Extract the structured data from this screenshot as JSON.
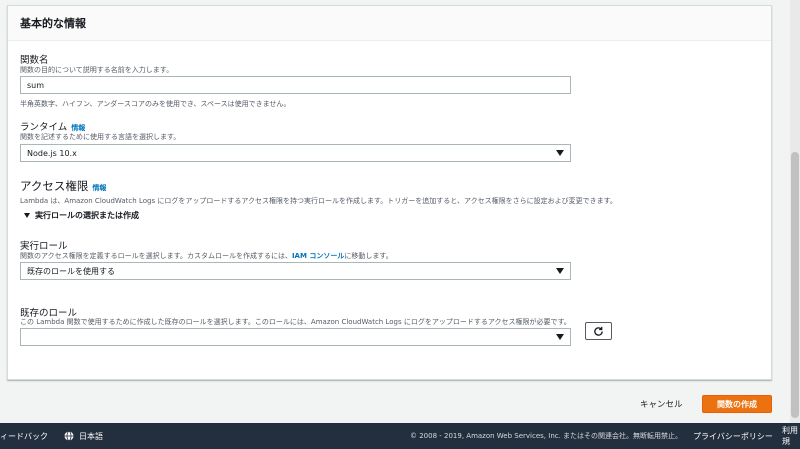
{
  "card": {
    "title": "基本的な情報"
  },
  "function_name": {
    "label": "関数名",
    "description": "関数の目的について説明する名前を入力します。",
    "value": "sum",
    "hint": "半角英数字、ハイフン、アンダースコアのみを使用でき、スペースは使用できません。"
  },
  "runtime": {
    "label": "ランタイム",
    "info": "情報",
    "description": "関数を記述するために使用する言語を選択します。",
    "value": "Node.js 10.x"
  },
  "permissions": {
    "title": "アクセス権限",
    "info": "情報",
    "description": "Lambda は、Amazon CloudWatch Logs にログをアップロードするアクセス権限を持つ実行ロールを作成します。トリガーを追加すると、アクセス権限をさらに設定および変更できます。",
    "toggle_label": "実行ロールの選択または作成"
  },
  "execution_role": {
    "label": "実行ロール",
    "description_before": "関数のアクセス権限を定義するロールを選択します。カスタムロールを作成するには、",
    "link": "IAM コンソール",
    "description_after": "に移動します。",
    "value": "既存のロールを使用する"
  },
  "existing_role": {
    "label": "既存のロール",
    "description": "この Lambda 関数で使用するために作成した既存のロールを選択します。このロールには、Amazon CloudWatch Logs にログをアップロードするアクセス権限が必要です。",
    "value": ""
  },
  "actions": {
    "cancel": "キャンセル",
    "create": "関数の作成"
  },
  "footer": {
    "feedback": "ィードバック",
    "language": "日本語",
    "copyright": "© 2008 - 2019, Amazon Web Services, Inc. またはその関連会社。無断転用禁止。",
    "privacy": "プライバシーポリシー",
    "terms": "利用規"
  },
  "colors": {
    "primary": "#ec7211",
    "link": "#0073bb",
    "footer_bg": "#232f3e"
  }
}
